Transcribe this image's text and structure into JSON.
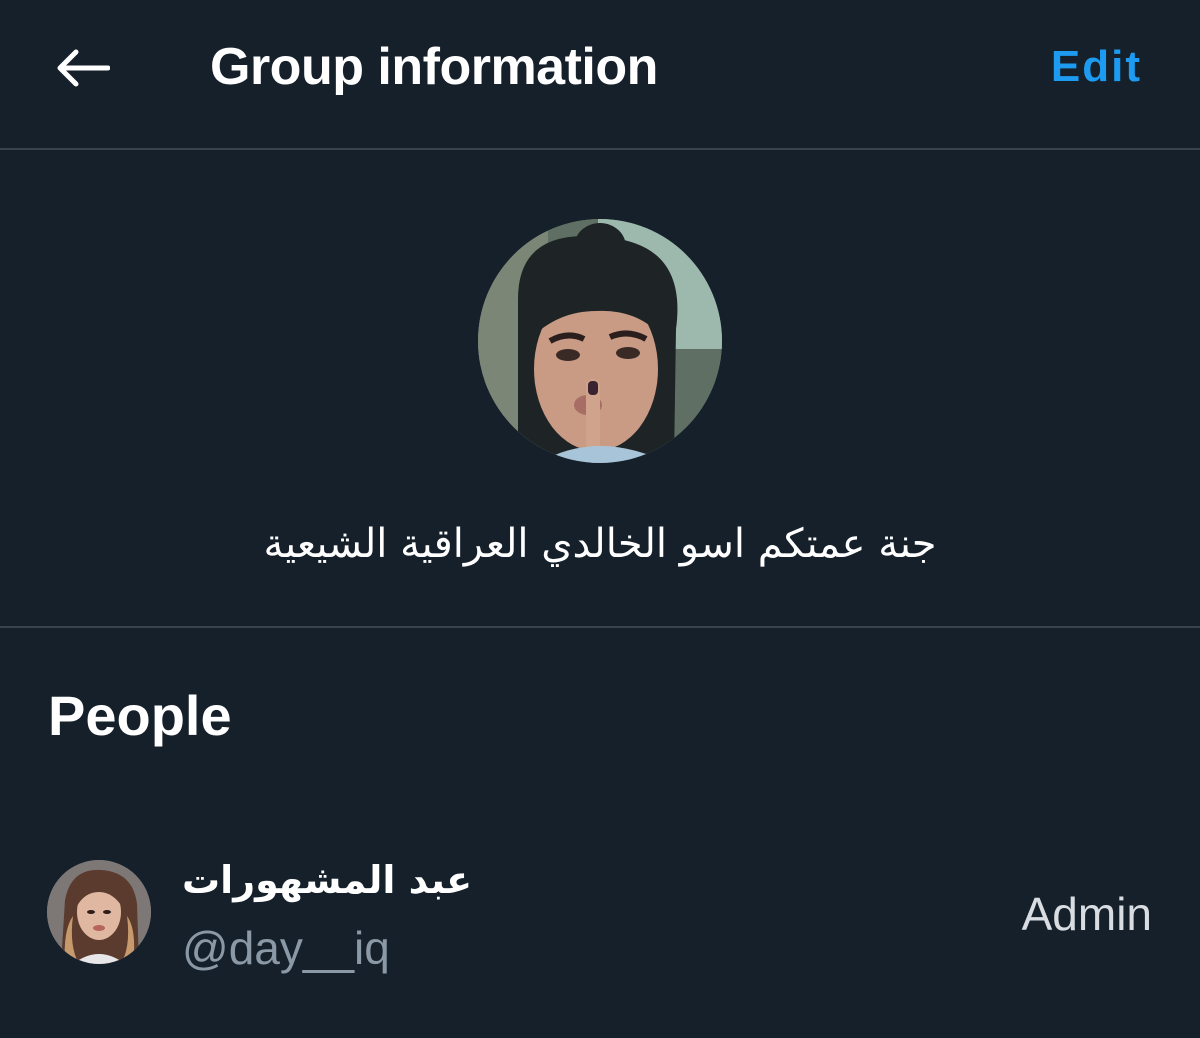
{
  "header": {
    "back_icon": "arrow-left-icon",
    "title": "Group information",
    "edit_label": "Edit"
  },
  "group": {
    "name": "جنة عمتكم اسو الخالدي العراقية الشيعية",
    "avatar": "group-photo"
  },
  "people": {
    "heading": "People",
    "members": [
      {
        "name": "عبد المشهورات",
        "handle": "@day__iq",
        "role": "Admin",
        "avatar": "member-photo"
      }
    ]
  },
  "colors": {
    "background": "#15202b",
    "divider": "#38444d",
    "accent": "#1d9bf0",
    "secondary_text": "#8b98a5"
  }
}
